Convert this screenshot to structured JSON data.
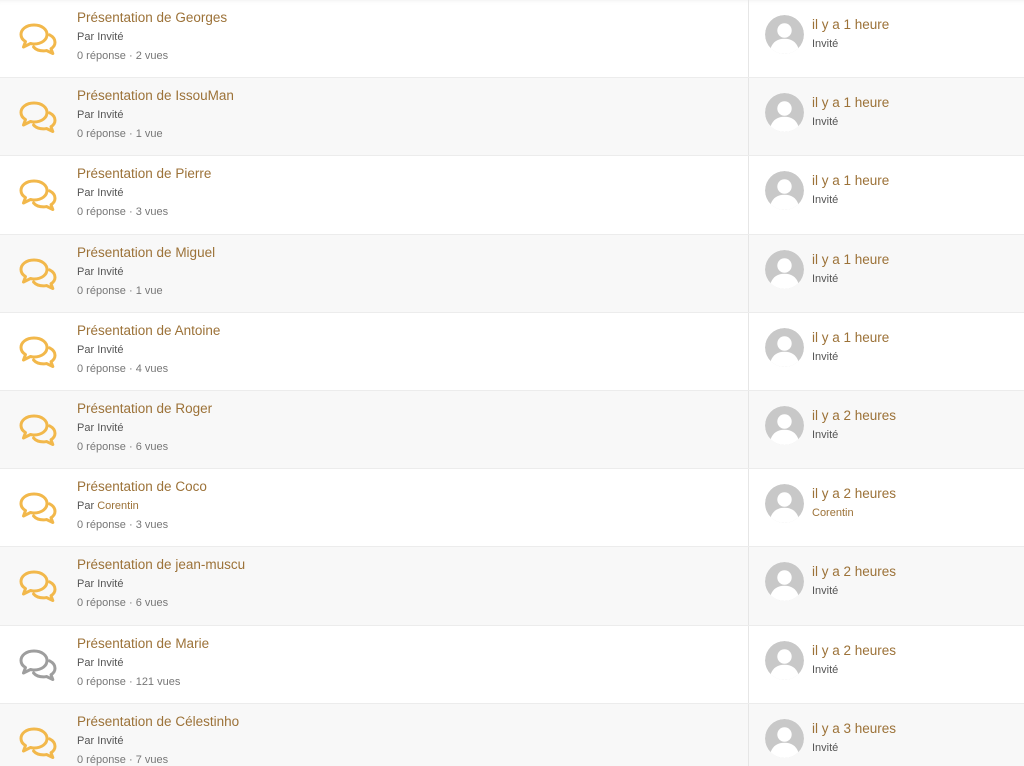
{
  "colors": {
    "link": "#9c7238",
    "icon_unread": "#f2b84b",
    "icon_read": "#9e9e9e",
    "row_alt": "#f8f8f8"
  },
  "topics": [
    {
      "title": "Présentation de Georges",
      "by_prefix": "Par",
      "author": "Invité",
      "author_link": false,
      "stats": "0 réponse · 2 vues",
      "last_time": "il y a 1 heure",
      "last_author": "Invité",
      "last_author_link": false,
      "icon": "chat-bubbles-icon",
      "unread": true
    },
    {
      "title": "Présentation de IssouMan",
      "by_prefix": "Par",
      "author": "Invité",
      "author_link": false,
      "stats": "0 réponse · 1 vue",
      "last_time": "il y a 1 heure",
      "last_author": "Invité",
      "last_author_link": false,
      "icon": "chat-bubbles-icon",
      "unread": true
    },
    {
      "title": "Présentation de Pierre",
      "by_prefix": "Par",
      "author": "Invité",
      "author_link": false,
      "stats": "0 réponse · 3 vues",
      "last_time": "il y a 1 heure",
      "last_author": "Invité",
      "last_author_link": false,
      "icon": "chat-bubbles-icon",
      "unread": true
    },
    {
      "title": "Présentation de Miguel",
      "by_prefix": "Par",
      "author": "Invité",
      "author_link": false,
      "stats": "0 réponse · 1 vue",
      "last_time": "il y a 1 heure",
      "last_author": "Invité",
      "last_author_link": false,
      "icon": "chat-bubbles-icon",
      "unread": true
    },
    {
      "title": "Présentation de Antoine",
      "by_prefix": "Par",
      "author": "Invité",
      "author_link": false,
      "stats": "0 réponse · 4 vues",
      "last_time": "il y a 1 heure",
      "last_author": "Invité",
      "last_author_link": false,
      "icon": "chat-bubbles-icon",
      "unread": true
    },
    {
      "title": "Présentation de Roger",
      "by_prefix": "Par",
      "author": "Invité",
      "author_link": false,
      "stats": "0 réponse · 6 vues",
      "last_time": "il y a 2 heures",
      "last_author": "Invité",
      "last_author_link": false,
      "icon": "chat-bubbles-icon",
      "unread": true
    },
    {
      "title": "Présentation de Coco",
      "by_prefix": "Par",
      "author": "Corentin",
      "author_link": true,
      "stats": "0 réponse · 3 vues",
      "last_time": "il y a 2 heures",
      "last_author": "Corentin",
      "last_author_link": true,
      "icon": "chat-bubbles-icon",
      "unread": true
    },
    {
      "title": "Présentation de jean-muscu",
      "by_prefix": "Par",
      "author": "Invité",
      "author_link": false,
      "stats": "0 réponse · 6 vues",
      "last_time": "il y a 2 heures",
      "last_author": "Invité",
      "last_author_link": false,
      "icon": "chat-bubbles-icon",
      "unread": true
    },
    {
      "title": "Présentation de Marie",
      "by_prefix": "Par",
      "author": "Invité",
      "author_link": false,
      "stats": "0 réponse · 121 vues",
      "last_time": "il y a 2 heures",
      "last_author": "Invité",
      "last_author_link": false,
      "icon": "chat-bubbles-icon",
      "unread": false
    },
    {
      "title": "Présentation de Célestinho",
      "by_prefix": "Par",
      "author": "Invité",
      "author_link": false,
      "stats": "0 réponse · 7 vues",
      "last_time": "il y a 3 heures",
      "last_author": "Invité",
      "last_author_link": false,
      "icon": "chat-bubbles-icon",
      "unread": true
    }
  ]
}
